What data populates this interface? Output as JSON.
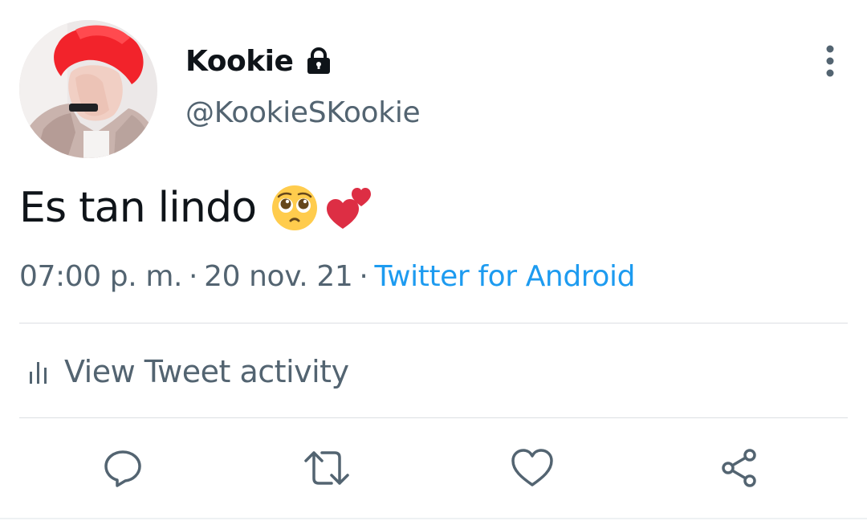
{
  "user": {
    "display_name": "Kookie",
    "handle": "@KookieSKookie",
    "protected": true,
    "protected_icon": "lock-icon",
    "avatar_icon": "avatar-photo"
  },
  "tweet": {
    "text": "Es tan lindo",
    "emojis": [
      "pleading-face",
      "two-hearts"
    ],
    "time": "07:00 p. m.",
    "separator": "·",
    "date": "20 nov. 21",
    "source": "Twitter for Android"
  },
  "activity": {
    "label": "View Tweet activity",
    "icon": "bar-chart-icon"
  },
  "actions": {
    "reply_icon": "reply-icon",
    "retweet_icon": "retweet-icon",
    "like_icon": "heart-icon",
    "share_icon": "share-icon"
  },
  "more_icon": "more-vertical-icon",
  "colors": {
    "text_primary": "#0f1419",
    "text_secondary": "#536471",
    "link": "#1d9bf0",
    "divider": "#dcdfe3",
    "emoji_heart": "#e0245e",
    "emoji_face": "#ffcc4d"
  }
}
